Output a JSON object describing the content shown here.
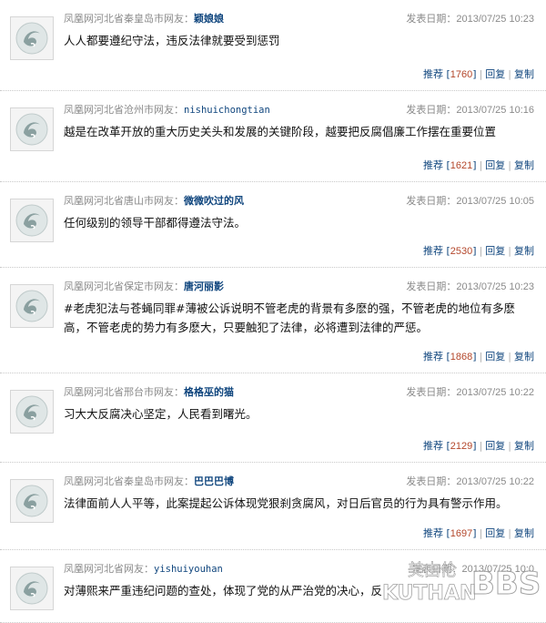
{
  "meta_label": "发表日期：",
  "actions": {
    "recommend": "推荐",
    "reply": "回复",
    "copy": "复制"
  },
  "colors": {
    "username": "#10467e",
    "count": "#b3462a",
    "meta": "#8a8a8a"
  },
  "comments": [
    {
      "location": "凤凰网河北省秦皇岛市网友：",
      "username": "颖娘娘",
      "time": "2013/07/25 10:23",
      "content": "人人都要遵纪守法，违反法律就要受到惩罚",
      "count": "1760"
    },
    {
      "location": "凤凰网河北省沧州市网友：",
      "username": "nishuichongtian",
      "time": "2013/07/25 10:16",
      "content": "越是在改革开放的重大历史关头和发展的关键阶段，越要把反腐倡廉工作摆在重要位置",
      "count": "1621"
    },
    {
      "location": "凤凰网河北省唐山市网友：",
      "username": "微微吹过的风",
      "time": "2013/07/25 10:05",
      "content": "任何级别的领导干部都得遵法守法。",
      "count": "2530"
    },
    {
      "location": "凤凰网河北省保定市网友：",
      "username": "唐河丽影",
      "time": "2013/07/25 10:23",
      "content": "#老虎犯法与苍蝇同罪#薄被公诉说明不管老虎的背景有多麽的强，不管老虎的地位有多麽高，不管老虎的势力有多麽大，只要触犯了法律，必将遭到法律的严惩。",
      "count": "1868"
    },
    {
      "location": "凤凰网河北省邢台市网友：",
      "username": "格格巫的猫",
      "time": "2013/07/25 10:22",
      "content": "习大大反腐决心坚定，人民看到曙光。",
      "count": "2129"
    },
    {
      "location": "凤凰网河北省秦皇岛市网友：",
      "username": "巴巴巴博",
      "time": "2013/07/25 10:22",
      "content": "法律面前人人平等，此案提起公诉体现党狠刹贪腐风，对日后官员的行为具有警示作用。",
      "count": "1697"
    },
    {
      "location": "凤凰网河北省网友：",
      "username": "yishuiyouhan",
      "time": "2013/07/25 10:0",
      "content": "对薄熙来严重违纪问题的查处，体现了党的从严治党的决心，反",
      "count": ""
    }
  ],
  "watermark": {
    "cn": "美由伦",
    "en": "KUTHAN",
    "bbs": "BBS"
  }
}
